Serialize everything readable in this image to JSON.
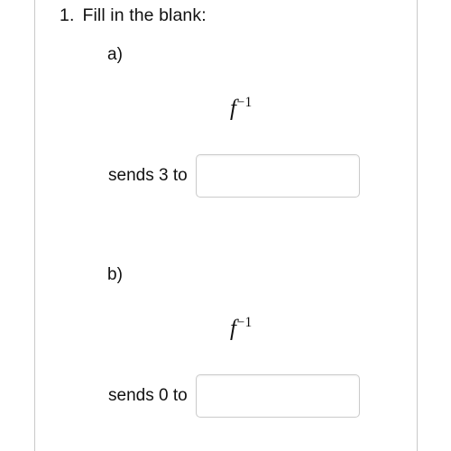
{
  "page": {
    "background_color": "#ffffff",
    "rule_color": "#c9c9c9"
  },
  "question": {
    "number": "1.",
    "prompt": "Fill in the blank:"
  },
  "parts": [
    {
      "label": "a)",
      "expression_base": "f",
      "expression_exponent": "−1",
      "sends_text": "sends 3 to",
      "input_value": "",
      "input_placeholder": ""
    },
    {
      "label": "b)",
      "expression_base": "f",
      "expression_exponent": "−1",
      "sends_text": "sends 0 to",
      "input_value": "",
      "input_placeholder": ""
    }
  ]
}
